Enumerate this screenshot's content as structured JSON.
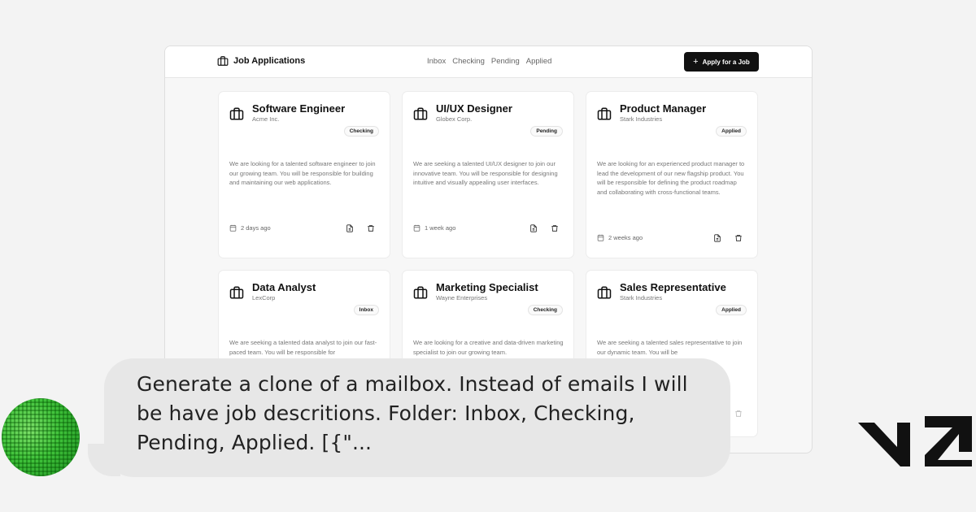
{
  "app": {
    "title": "Job Applications",
    "nav": [
      "Inbox",
      "Checking",
      "Pending",
      "Applied"
    ],
    "apply_button": "Apply for a Job"
  },
  "jobs": [
    {
      "title": "Software Engineer",
      "company": "Acme Inc.",
      "status": "Checking",
      "description": "We are looking for a talented software engineer to join our growing team. You will be responsible for building and maintaining our web applications.",
      "time": "2 days ago"
    },
    {
      "title": "UI/UX Designer",
      "company": "Globex Corp.",
      "status": "Pending",
      "description": "We are seeking a talented UI/UX designer to join our innovative team. You will be responsible for designing intuitive and visually appealing user interfaces.",
      "time": "1 week ago"
    },
    {
      "title": "Product Manager",
      "company": "Stark Industries",
      "status": "Applied",
      "description": "We are looking for an experienced product manager to lead the development of our new flagship product. You will be responsible for defining the product roadmap and collaborating with cross-functional teams.",
      "time": "2 weeks ago"
    },
    {
      "title": "Data Analyst",
      "company": "LexCorp",
      "status": "Inbox",
      "description": "We are seeking a talented data analyst to join our fast-paced team. You will be responsible for",
      "time": ""
    },
    {
      "title": "Marketing Specialist",
      "company": "Wayne Enterprises",
      "status": "Checking",
      "description": "We are looking for a creative and data-driven marketing specialist to join our growing team.",
      "time": ""
    },
    {
      "title": "Sales Representative",
      "company": "Stark Industries",
      "status": "Applied",
      "description": "We are seeking a talented sales representative to join our dynamic team. You will be",
      "time": ""
    }
  ],
  "chat": {
    "message": "Generate a clone of a mailbox. Instead of emails I will be have job descritions. Folder: Inbox, Checking, Pending, Applied. [{\"..."
  },
  "icons": {
    "brand": "briefcase-icon",
    "card": "briefcase-icon",
    "time": "calendar-icon",
    "view": "document-icon",
    "delete": "trash-icon"
  }
}
